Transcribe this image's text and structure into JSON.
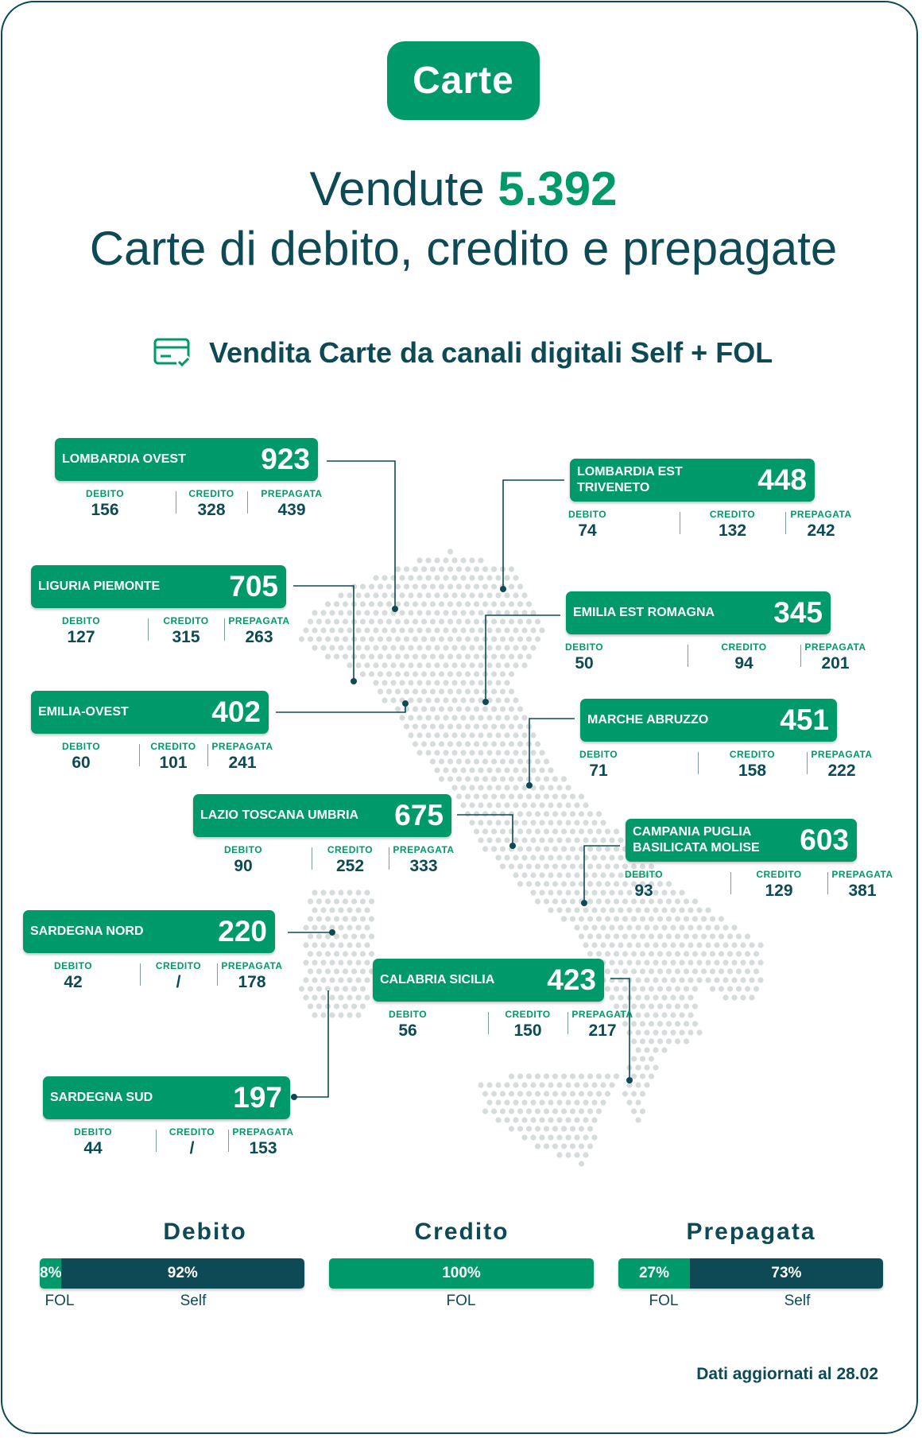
{
  "header": {
    "badge": "Carte",
    "sold_label": "Vendute",
    "sold_total": "5.392",
    "subtitle": "Carte di debito, credito e prepagate",
    "section_title": "Vendita Carte da canali digitali Self + FOL",
    "section_icon": "card-check-icon"
  },
  "stat_labels": {
    "debito": "DEBITO",
    "credito": "CREDITO",
    "prepagata": "PREPAGATA"
  },
  "regions": [
    {
      "name": "LOMBARDIA OVEST",
      "total": "923",
      "debito": "156",
      "credito": "328",
      "prepagata": "439"
    },
    {
      "name": "LOMBARDIA EST TRIVENETO",
      "total": "448",
      "debito": "74",
      "credito": "132",
      "prepagata": "242"
    },
    {
      "name": "LIGURIA PIEMONTE",
      "total": "705",
      "debito": "127",
      "credito": "315",
      "prepagata": "263"
    },
    {
      "name": "EMILIA EST ROMAGNA",
      "total": "345",
      "debito": "50",
      "credito": "94",
      "prepagata": "201"
    },
    {
      "name": "EMILIA-OVEST",
      "total": "402",
      "debito": "60",
      "credito": "101",
      "prepagata": "241"
    },
    {
      "name": "MARCHE ABRUZZO",
      "total": "451",
      "debito": "71",
      "credito": "158",
      "prepagata": "222"
    },
    {
      "name": "LAZIO TOSCANA UMBRIA",
      "total": "675",
      "debito": "90",
      "credito": "252",
      "prepagata": "333"
    },
    {
      "name": "CAMPANIA PUGLIA BASILICATA MOLISE",
      "total": "603",
      "debito": "93",
      "credito": "129",
      "prepagata": "381"
    },
    {
      "name": "SARDEGNA NORD",
      "total": "220",
      "debito": "42",
      "credito": "/",
      "prepagata": "178"
    },
    {
      "name": "CALABRIA SICILIA",
      "total": "423",
      "debito": "56",
      "credito": "150",
      "prepagata": "217"
    },
    {
      "name": "SARDEGNA SUD",
      "total": "197",
      "debito": "44",
      "credito": "/",
      "prepagata": "153"
    }
  ],
  "split": [
    {
      "title": "Debito",
      "fol_pct": 8,
      "self_pct": 92,
      "fol_text": "8%",
      "self_text": "92%",
      "fol_label": "FOL",
      "self_label": "Self"
    },
    {
      "title": "Credito",
      "fol_pct": 100,
      "self_pct": 0,
      "fol_text": "100%",
      "self_text": "",
      "fol_label": "FOL",
      "self_label": ""
    },
    {
      "title": "Prepagata",
      "fol_pct": 27,
      "self_pct": 73,
      "fol_text": "27%",
      "self_text": "73%",
      "fol_label": "FOL",
      "self_label": "Self"
    }
  ],
  "footer": "Dati aggiornati al 28.02",
  "colors": {
    "primary": "#00996a",
    "dark": "#0d4a55",
    "map_dot": "#d6dbdc",
    "border": "#0d4a55"
  }
}
